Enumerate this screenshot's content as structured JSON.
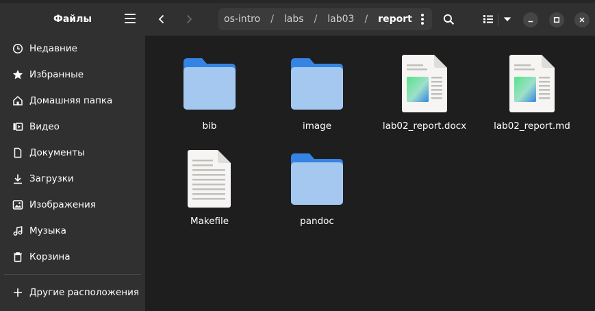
{
  "sidebar": {
    "title": "Файлы",
    "items": [
      {
        "label": "Недавние",
        "icon": "clock-icon"
      },
      {
        "label": "Избранные",
        "icon": "star-icon"
      },
      {
        "label": "Домашняя папка",
        "icon": "home-icon"
      },
      {
        "label": "Видео",
        "icon": "video-icon"
      },
      {
        "label": "Документы",
        "icon": "document-icon"
      },
      {
        "label": "Загрузки",
        "icon": "download-icon"
      },
      {
        "label": "Изображения",
        "icon": "image-icon"
      },
      {
        "label": "Музыка",
        "icon": "music-icon"
      },
      {
        "label": "Корзина",
        "icon": "trash-icon"
      }
    ],
    "other_locations": "Другие расположения"
  },
  "path": {
    "crumbs": [
      "os-intro",
      "labs",
      "lab03"
    ],
    "current": "report",
    "separator": "/"
  },
  "files": [
    {
      "name": "bib",
      "type": "folder"
    },
    {
      "name": "image",
      "type": "folder"
    },
    {
      "name": "lab02_report.docx",
      "type": "image-document"
    },
    {
      "name": "lab02_report.md",
      "type": "image-document"
    },
    {
      "name": "Makefile",
      "type": "text-document"
    },
    {
      "name": "pandoc",
      "type": "folder"
    }
  ],
  "colors": {
    "folder_back": "#3584e4",
    "folder_front": "#a4c8f0",
    "sidebar_bg": "#303030",
    "content_bg": "#1e1e1e"
  }
}
